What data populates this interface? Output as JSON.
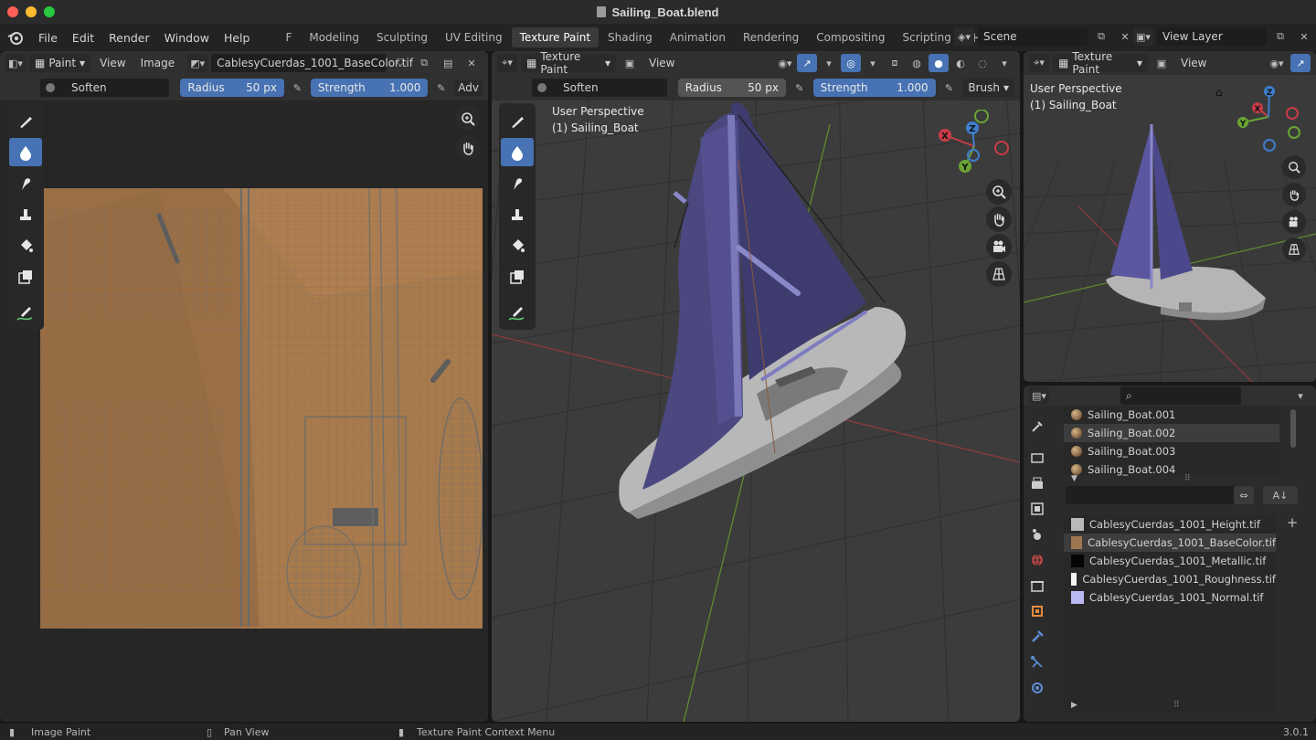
{
  "window": {
    "title": "Sailing_Boat.blend"
  },
  "menu": {
    "file": "File",
    "edit": "Edit",
    "render": "Render",
    "window": "Window",
    "help": "Help"
  },
  "workspaces": [
    "F",
    "Modeling",
    "Sculpting",
    "UV Editing",
    "Texture Paint",
    "Shading",
    "Animation",
    "Rendering",
    "Compositing",
    "Scripting",
    "+"
  ],
  "active_workspace": "Texture Paint",
  "scene": {
    "name": "Scene"
  },
  "view_layer": {
    "name": "View Layer"
  },
  "image_editor": {
    "mode": "Paint",
    "view_menu": "View",
    "image_menu": "Image",
    "image_name": "CablesyCuerdas_1001_BaseColor.tif",
    "brush_name": "Soften",
    "radius_label": "Radius",
    "radius_value": "50 px",
    "strength_label": "Strength",
    "strength_value": "1.000",
    "adv_label": "Adv"
  },
  "viewport": {
    "mode": "Texture Paint",
    "view_menu": "View",
    "brush_name": "Soften",
    "radius_label": "Radius",
    "radius_value": "50 px",
    "strength_label": "Strength",
    "strength_value": "1.000",
    "brush_menu": "Brush",
    "overlay_line1": "User Perspective",
    "overlay_line2": "(1) Sailing_Boat"
  },
  "mini_viewport": {
    "mode": "Texture Paint",
    "view_menu": "View",
    "overlay_line1": "User Perspective",
    "overlay_line2": "(1) Sailing_Boat"
  },
  "gizmo": {
    "x": "X",
    "y": "Y",
    "z": "Z"
  },
  "materials": [
    {
      "name": "Sailing_Boat.001",
      "selected": false
    },
    {
      "name": "Sailing_Boat.002",
      "selected": true
    },
    {
      "name": "Sailing_Boat.003",
      "selected": false
    },
    {
      "name": "Sailing_Boat.004",
      "selected": false
    }
  ],
  "texture_slots": [
    {
      "name": "CablesyCuerdas_1001_Height.tif",
      "swatch": "#b9b9b9",
      "selected": false
    },
    {
      "name": "CablesyCuerdas_1001_BaseColor.tif",
      "swatch": "#a07650",
      "selected": true
    },
    {
      "name": "CablesyCuerdas_1001_Metallic.tif",
      "swatch": "#050505",
      "selected": false
    },
    {
      "name": "CablesyCuerdas_1001_Roughness.tif",
      "swatch": "#f4f4f4",
      "selected": false
    },
    {
      "name": "CablesyCuerdas_1001_Normal.tif",
      "swatch": "#b9b8f0",
      "selected": false
    }
  ],
  "status_bar": {
    "left": "Image Paint",
    "middle": "Pan View",
    "right": "Texture Paint Context Menu",
    "version": "3.0.1"
  },
  "colors": {
    "accent": "#4772b3",
    "texture": "#a87a4c"
  }
}
